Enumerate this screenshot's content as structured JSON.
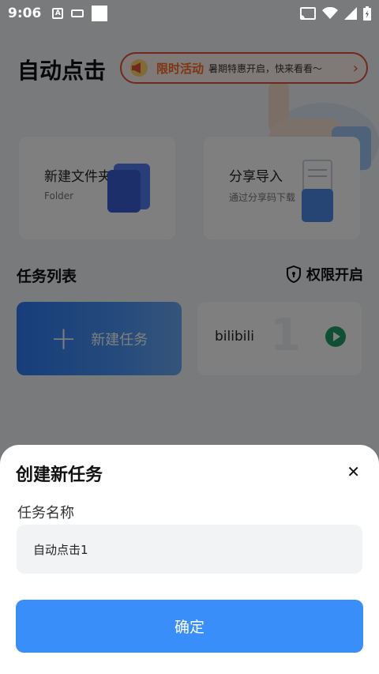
{
  "status_bar": {
    "time": "9:06"
  },
  "app": {
    "title": "自动点击"
  },
  "promo": {
    "tag": "限时活动",
    "text": "暑期特惠开启，快来看看～"
  },
  "cards": [
    {
      "title": "新建文件夹",
      "subtitle": "Folder"
    },
    {
      "title": "分享导入",
      "subtitle": "通过分享码下载"
    }
  ],
  "task_section": {
    "title": "任务列表",
    "permission_label": "权限开启"
  },
  "tasks": {
    "new_task_label": "新建任务",
    "items": [
      {
        "name": "bilibili",
        "number": "1"
      }
    ]
  },
  "dialog": {
    "title": "创建新任务",
    "field_label": "任务名称",
    "field_value": "自动点击1",
    "confirm_label": "确定"
  },
  "colors": {
    "primary": "#3a8ef9",
    "promo_accent": "#ff6a22",
    "play_green": "#1f9e6a"
  }
}
